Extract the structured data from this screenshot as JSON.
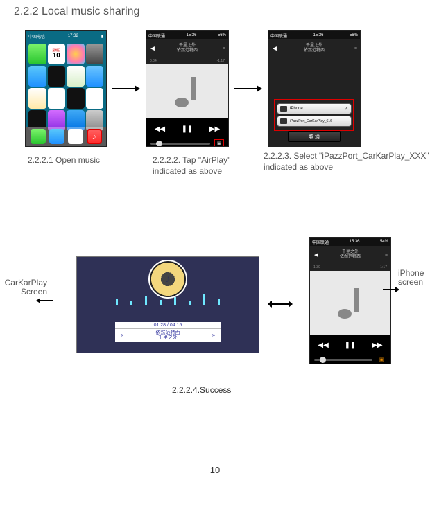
{
  "sectionTitle": "2.2.2 Local music sharing",
  "captions": {
    "c1": "2.2.2.1 Open music",
    "c2": "2.2.2.2. Tap \"AirPlay\" indicated as above",
    "c3": "2.2.2.3. Select \"iPazzPort_CarKarPlay_XXX\" indicated as above",
    "c4": "2.2.2.4.Success"
  },
  "labels": {
    "left1": "CarKarPlay",
    "left2": "Screen",
    "right1": "iPhone",
    "right2": "screen"
  },
  "pageNumber": "10",
  "homeStatus": {
    "carrier": "中国电信",
    "time": "17:32"
  },
  "homeApps": {
    "row1": [
      "Messages",
      "Calendar",
      "Photos",
      "Camera"
    ],
    "row2": [
      "Weather",
      "Clock",
      "Maps",
      "Videos"
    ],
    "row3": [
      "Notes",
      "Reminders",
      "Stocks",
      "Game Center"
    ],
    "row4": [
      "Passbook",
      "iTunes Store",
      "App Store",
      "Settings"
    ]
  },
  "calendar": {
    "dow": "星期日",
    "day": "10"
  },
  "dockApps": [
    "Phone",
    "Mail",
    "Safari",
    "Music"
  ],
  "musicPlayer": {
    "status": {
      "carrier": "中国联通",
      "time": "15:36",
      "battery": "56%"
    },
    "title1": "千里之外",
    "title2": "依然范特西",
    "timeLeft": "0:04",
    "timeRight": "-1:17",
    "prev": "◀◀",
    "pause": "❚❚",
    "next": "▶▶"
  },
  "selectPanel": {
    "row1": "iPhone",
    "row2": "iPazzPort_CarKarPlay_616",
    "check": "✓",
    "cancel": "取 消"
  },
  "carScreen": {
    "time": "01:28 / 04:15",
    "song1": "依然范特西",
    "song2": "千里之外",
    "prev": "«",
    "next": "»"
  },
  "musicPlayer2": {
    "status": {
      "carrier": "中国联通",
      "time": "15:36",
      "battery": "54%"
    },
    "timeLeft": "1:30",
    "timeRight": "-1:17"
  },
  "eqHeights": [
    10,
    6,
    14,
    8,
    12,
    7,
    16,
    9
  ]
}
